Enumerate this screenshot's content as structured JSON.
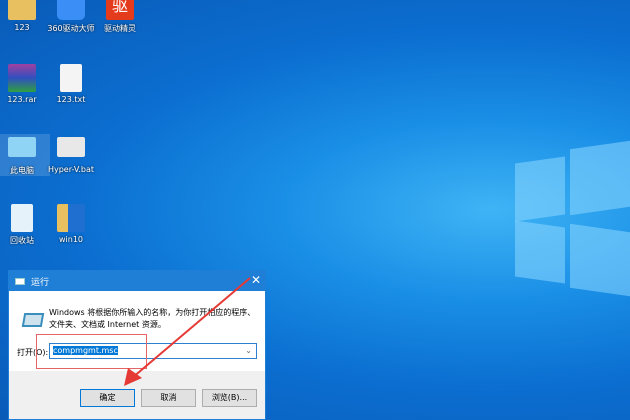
{
  "desktop_icons": [
    {
      "label": "123",
      "type": "folder"
    },
    {
      "label": "360驱动大师",
      "type": "app"
    },
    {
      "label": "驱动精灵",
      "type": "app",
      "glyph": "驱"
    },
    {
      "label": "123.rar",
      "type": "archive"
    },
    {
      "label": "123.txt",
      "type": "text"
    },
    {
      "label": "此电脑",
      "type": "computer"
    },
    {
      "label": "Hyper-V.bat",
      "type": "batch"
    },
    {
      "label": "回收站",
      "type": "recycle-bin"
    },
    {
      "label": "win10",
      "type": "folder"
    }
  ],
  "dialog": {
    "title": "运行",
    "description": "Windows 将根据你所输入的名称，为你打开相应的程序、文件夹、文档或 Internet 资源。",
    "open_label": "打开(O):",
    "input_value": "compmgmt.msc",
    "ok": "确定",
    "cancel": "取消",
    "browse": "浏览(B)..."
  },
  "colors": {
    "accent": "#1f7ed6",
    "annotation": "#e53935"
  }
}
